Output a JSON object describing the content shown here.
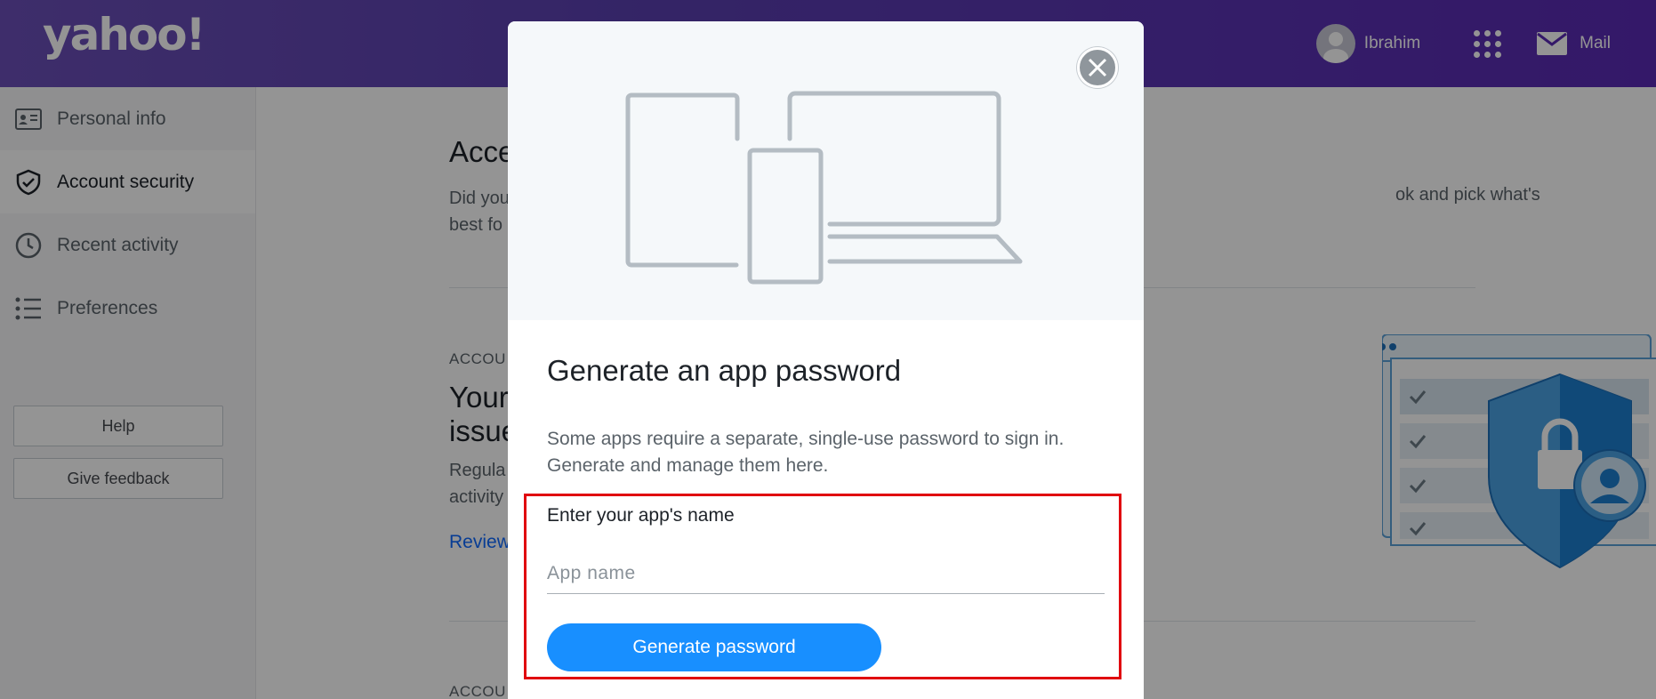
{
  "header": {
    "logo": "yahoo!",
    "user_name": "Ibrahim",
    "apps_icon": "grid-icon",
    "mail_label": "Mail",
    "mail_icon": "envelope-icon"
  },
  "sidebar": {
    "items": [
      {
        "label": "Personal info",
        "icon": "id-card-icon",
        "active": false
      },
      {
        "label": "Account security",
        "icon": "shield-check-icon",
        "active": true
      },
      {
        "label": "Recent activity",
        "icon": "clock-icon",
        "active": false
      },
      {
        "label": "Preferences",
        "icon": "list-icon",
        "active": false
      }
    ],
    "help_label": "Help",
    "feedback_label": "Give feedback"
  },
  "main": {
    "title": "Acce",
    "desc_line1": "Did you",
    "desc_line2": "best fo",
    "desc_right": "ok and pick what's",
    "section1_label": "ACCOU",
    "section1_title_line1": "Your",
    "section1_title_line2": "issue",
    "section1_desc_line1": "Regula",
    "section1_desc_line2": "activity",
    "section1_link": "Review",
    "section2_label": "ACCOU"
  },
  "modal": {
    "close_icon": "close-icon",
    "illustration": "devices-illustration",
    "title": "Generate an app password",
    "description": "Some apps require a separate, single-use password to sign in. Generate and manage them here.",
    "field_label": "Enter your app's name",
    "field_placeholder": "App name",
    "field_value": "",
    "generate_button": "Generate password"
  },
  "colors": {
    "header_start": "#6b4fb8",
    "header_end": "#5b2ab5",
    "primary_button": "#188fff",
    "highlight_border": "#e0030f",
    "link": "#0f69ff"
  }
}
